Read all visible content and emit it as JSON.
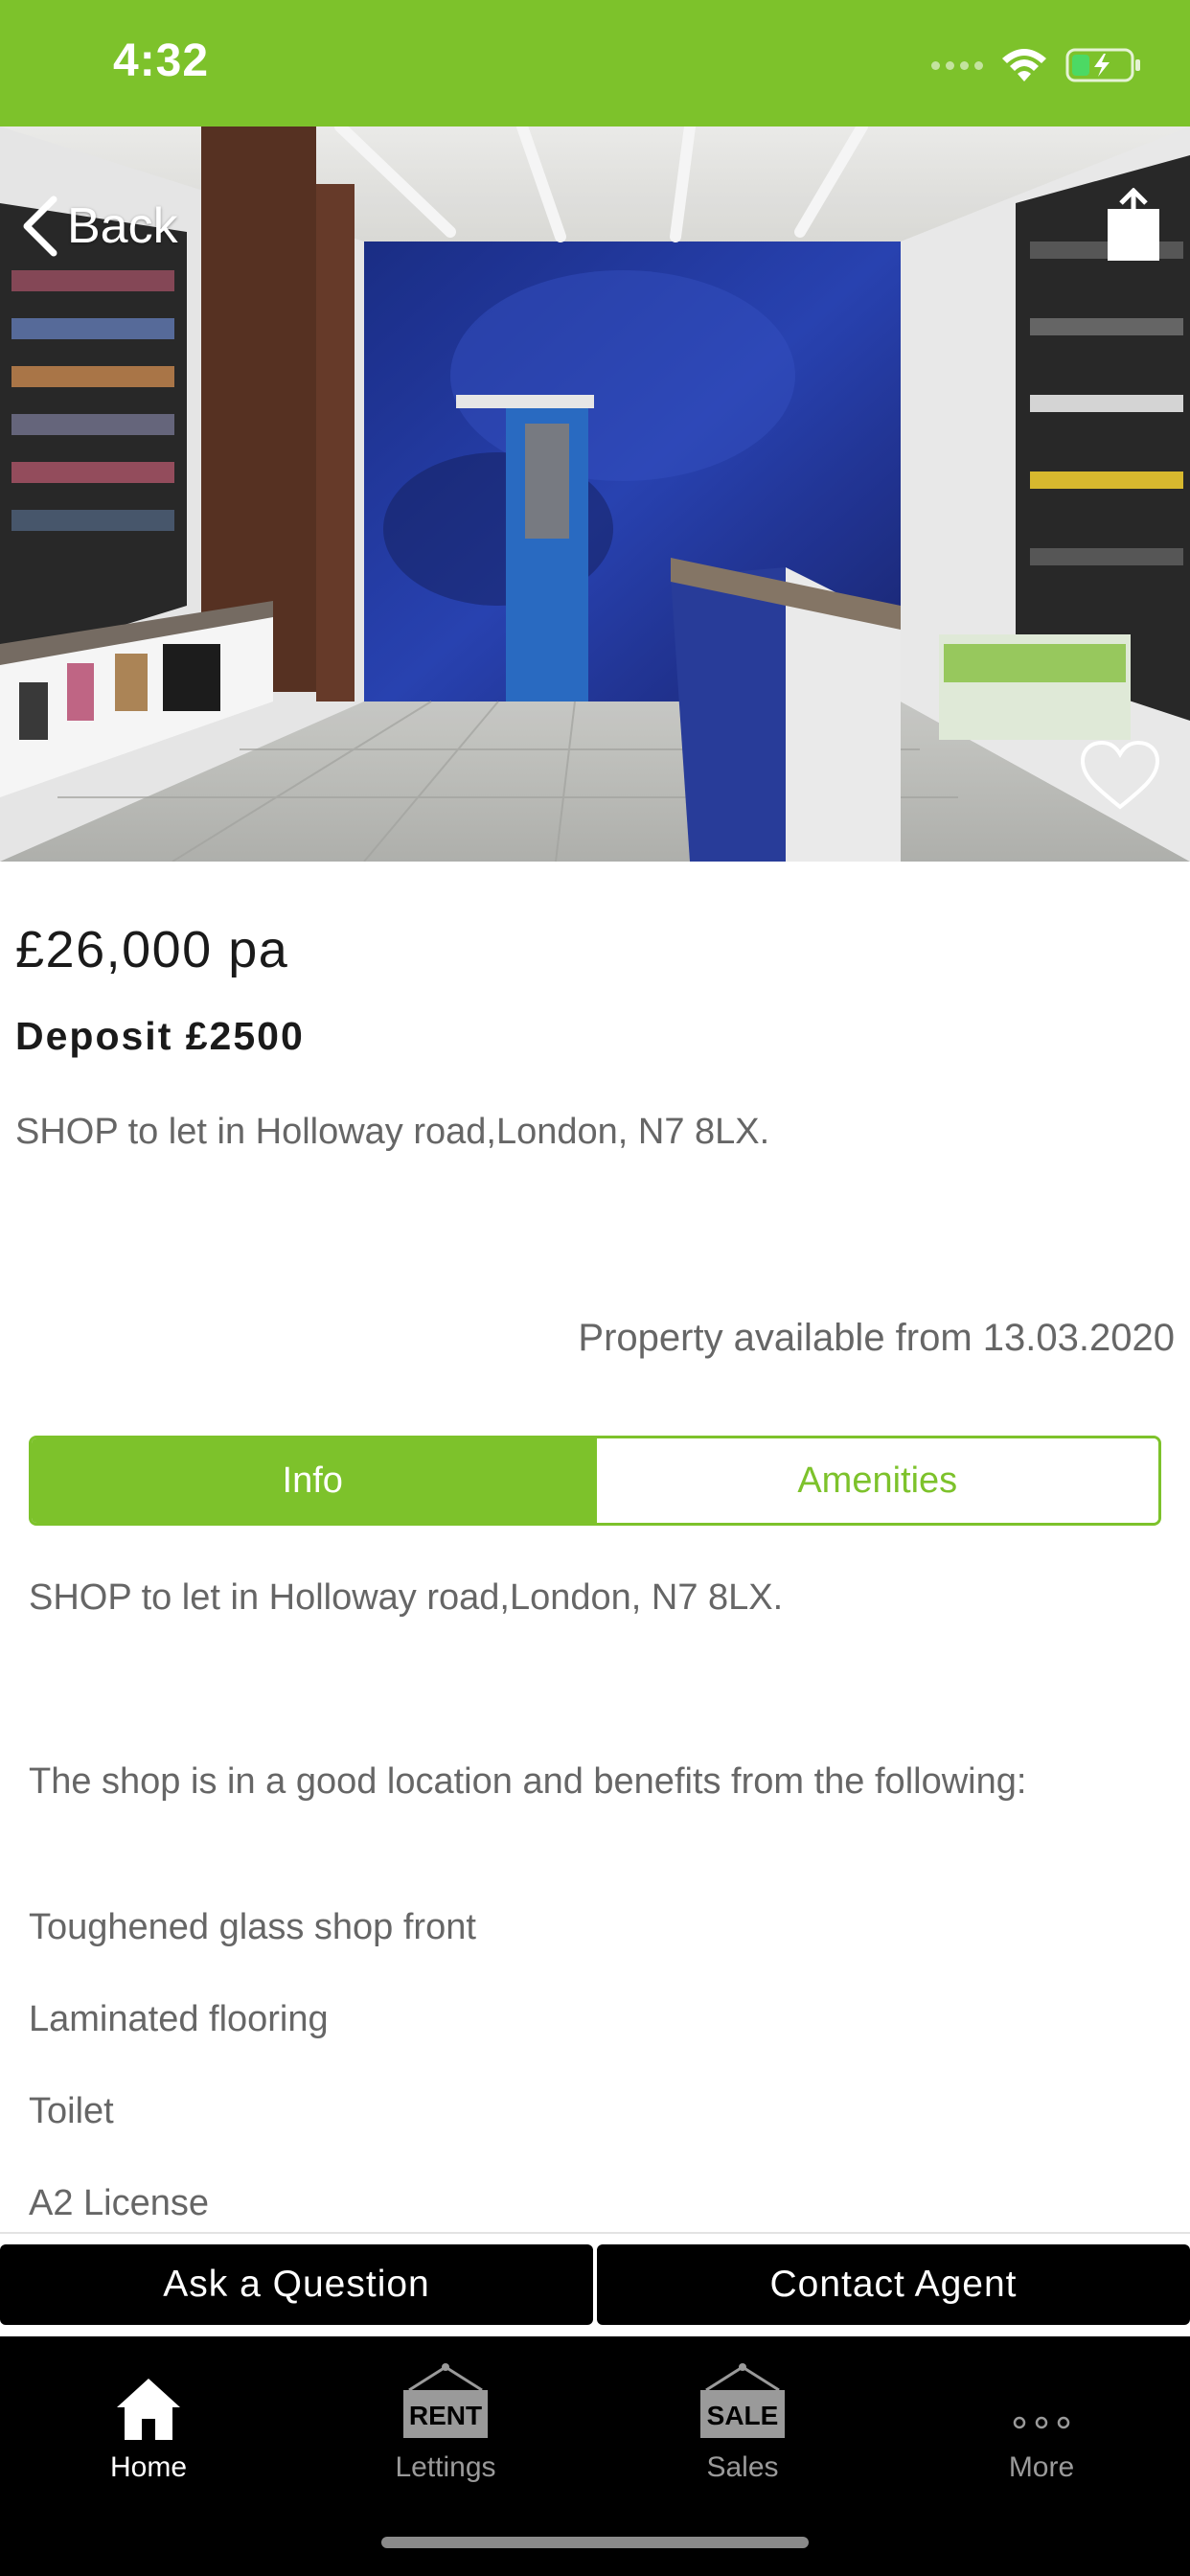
{
  "status_bar": {
    "time": "4:32"
  },
  "nav": {
    "back_label": "Back"
  },
  "listing": {
    "price": "£26,000 pa",
    "deposit": "Deposit £2500",
    "address": "SHOP to let in Holloway road,London, N7 8LX.",
    "available": "Property available from 13.03.2020"
  },
  "segments": {
    "info": "Info",
    "amenities": "Amenities",
    "selected": "Info"
  },
  "description": {
    "line1": "SHOP to let  in Holloway road,London, N7 8LX.",
    "line2": "The shop is in a good location and benefits from the following:",
    "line3": "Toughened glass shop front",
    "line4": "Laminated flooring",
    "line5": "Toilet",
    "line6": "A2 License"
  },
  "actions": {
    "ask": "Ask a Question",
    "contact": "Contact Agent"
  },
  "tabbar": {
    "items": [
      {
        "label": "Home",
        "icon": "home-icon",
        "active": true
      },
      {
        "label": "Lettings",
        "icon": "rent-sign-icon",
        "sign": "RENT"
      },
      {
        "label": "Sales",
        "icon": "sale-sign-icon",
        "sign": "SALE"
      },
      {
        "label": "More",
        "icon": "more-icon"
      }
    ]
  },
  "colors": {
    "accent": "#7dc22b",
    "text": "#666666",
    "dark": "#1a1a1a"
  }
}
